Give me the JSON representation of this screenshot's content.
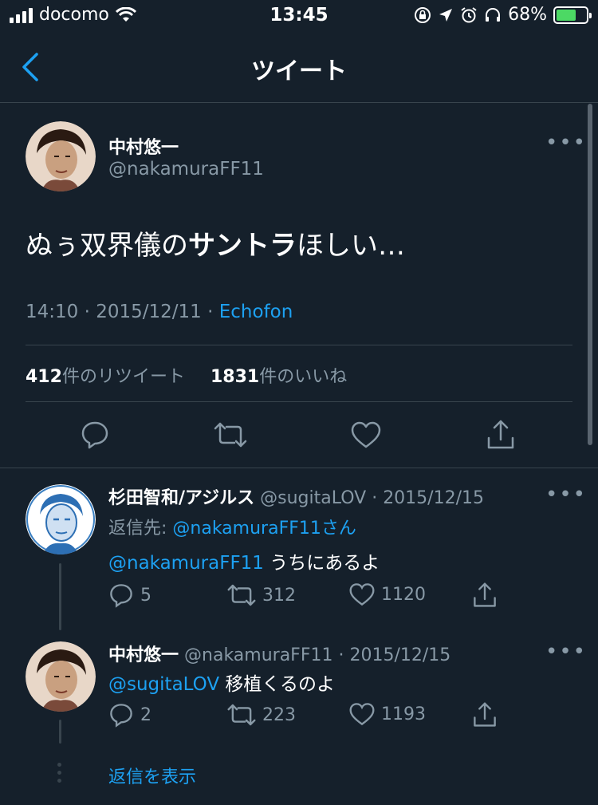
{
  "status_bar": {
    "carrier": "docomo",
    "time": "13:45",
    "battery": "68%",
    "battery_level": 0.68
  },
  "nav": {
    "title": "ツイート"
  },
  "main_tweet": {
    "display_name": "中村悠一",
    "handle": "@nakamuraFF11",
    "text_before": "ぬぅ双界儀の",
    "text_bold": "サントラ",
    "text_after": "ほしい…",
    "time": "14:10",
    "separator": "·",
    "date": "2015/12/11",
    "source": "Echofon",
    "retweet_count": "412",
    "retweet_label": "件のリツイート",
    "like_count": "1831",
    "like_label": "件のいいね"
  },
  "replies": [
    {
      "display_name": "杉田智和/アジルス",
      "handle": "@sugitaLOV",
      "date": "· 2015/12/15",
      "reply_to_label": "返信先: ",
      "reply_to_user": "@nakamuraFF11さん",
      "mention": "@nakamuraFF11",
      "text": " うちにあるよ",
      "reply_count": "5",
      "retweet_count": "312",
      "like_count": "1120"
    },
    {
      "display_name": "中村悠一",
      "handle": "@nakamuraFF11",
      "date": "· 2015/12/15",
      "mention": "@sugitaLOV",
      "text": " 移植くるのよ",
      "reply_count": "2",
      "retweet_count": "223",
      "like_count": "1193"
    }
  ],
  "show_replies": "返信を表示",
  "colors": {
    "background": "#15202b",
    "divider": "#38444d",
    "secondary_text": "#8899a6",
    "accent": "#1da1f2"
  }
}
